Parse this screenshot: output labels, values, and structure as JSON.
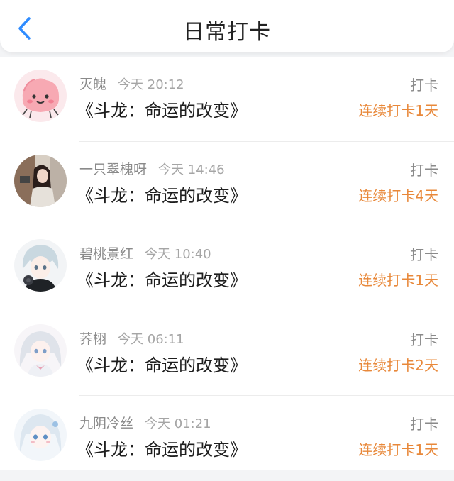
{
  "header": {
    "title": "日常打卡",
    "back_icon": "chevron-left-icon",
    "accent": "#2f8cff"
  },
  "colors": {
    "streak": "#e8883a"
  },
  "entries": [
    {
      "user": "灭魄",
      "time": "今天 20:12",
      "book": "《斗龙：命运的改变》",
      "action": "打卡",
      "streak": "连续打卡1天",
      "avatar": "pink-blob-avatar"
    },
    {
      "user": "一只翠槐呀",
      "time": "今天 14:46",
      "book": "《斗龙：命运的改变》",
      "action": "打卡",
      "streak": "连续打卡4天",
      "avatar": "girl-photo-avatar"
    },
    {
      "user": "碧桃景红",
      "time": "今天 10:40",
      "book": "《斗龙：命运的改变》",
      "action": "打卡",
      "streak": "连续打卡1天",
      "avatar": "anime-boy-avatar"
    },
    {
      "user": "荞栩",
      "time": "今天 06:11",
      "book": "《斗龙：命运的改变》",
      "action": "打卡",
      "streak": "连续打卡2天",
      "avatar": "anime-girl-avatar"
    },
    {
      "user": "九阴冷丝",
      "time": "今天 01:21",
      "book": "《斗龙：命运的改变》",
      "action": "打卡",
      "streak": "连续打卡1天",
      "avatar": "anime-girl-blue-avatar"
    }
  ]
}
